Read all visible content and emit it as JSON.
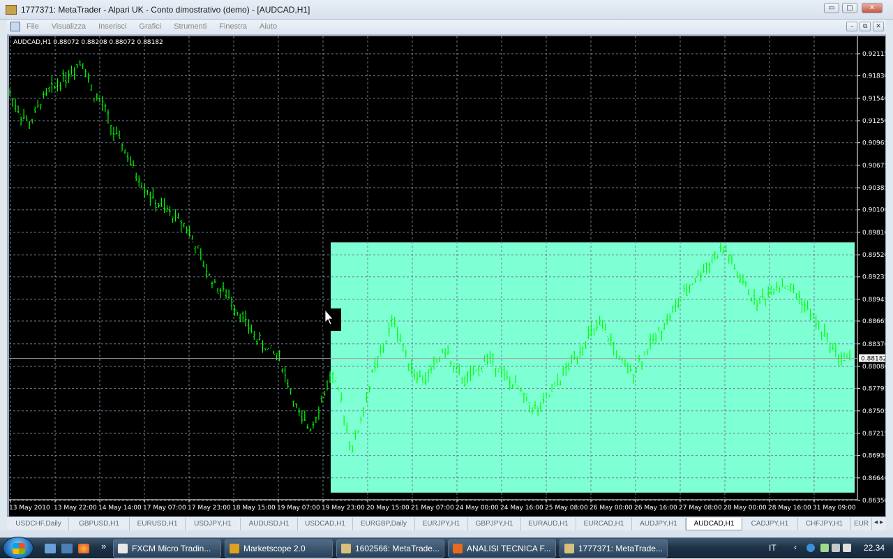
{
  "window": {
    "title": "1777371: MetaTrader - Alpari UK - Conto dimostrativo (demo) - [AUDCAD,H1]",
    "controls": {
      "minimize": "▭",
      "restore": "□",
      "close": "✕"
    }
  },
  "menu": {
    "items": [
      "File",
      "Visualizza",
      "Inserisci",
      "Grafici",
      "Strumenti",
      "Finestra",
      "Aiuto"
    ],
    "mdi_controls": {
      "minimize": "–",
      "restore": "⧉",
      "close": "✕"
    }
  },
  "chart_info": "AUDCAD,H1  0.88072 0.88208 0.88072 0.88182",
  "chart_data": {
    "type": "candlestick",
    "symbol": "AUDCAD",
    "timeframe": "H1",
    "ohlc": {
      "open": 0.88072,
      "high": 0.88208,
      "low": 0.88072,
      "close": 0.88182
    },
    "y_ticks": [
      "0.92115",
      "0.91830",
      "0.91540",
      "0.91250",
      "0.90965",
      "0.90675",
      "0.90385",
      "0.90100",
      "0.89810",
      "0.89520",
      "0.89235",
      "0.88945",
      "0.88665",
      "0.88370",
      "0.88080",
      "0.87795",
      "0.87505",
      "0.87215",
      "0.86930",
      "0.86640",
      "0.86350"
    ],
    "ylim": [
      0.8635,
      0.92115
    ],
    "current_price": "0.88182",
    "current_price_value": 0.88182,
    "x_ticks": [
      "13 May 2010",
      "13 May 22:00",
      "14 May 14:00",
      "17 May 07:00",
      "17 May 23:00",
      "18 May 15:00",
      "19 May 07:00",
      "19 May 23:00",
      "20 May 15:00",
      "21 May 07:00",
      "24 May 00:00",
      "24 May 16:00",
      "25 May 08:00",
      "26 May 00:00",
      "26 May 16:00",
      "27 May 08:00",
      "28 May 00:00",
      "28 May 16:00",
      "31 May 09:00"
    ],
    "price_path": [
      0.916,
      0.9135,
      0.912,
      0.915,
      0.9165,
      0.9178,
      0.919,
      0.9205,
      0.916,
      0.9145,
      0.911,
      0.909,
      0.906,
      0.904,
      0.902,
      0.901,
      0.9,
      0.899,
      0.896,
      0.893,
      0.891,
      0.89,
      0.888,
      0.886,
      0.884,
      0.883,
      0.882,
      0.878,
      0.874,
      0.873,
      0.876,
      0.88,
      0.876,
      0.87,
      0.8745,
      0.88,
      0.883,
      0.887,
      0.883,
      0.88,
      0.879,
      0.881,
      0.883,
      0.88,
      0.879,
      0.88,
      0.882,
      0.881,
      0.879,
      0.878,
      0.876,
      0.875,
      0.877,
      0.879,
      0.881,
      0.883,
      0.885,
      0.886,
      0.884,
      0.881,
      0.88,
      0.882,
      0.884,
      0.886,
      0.888,
      0.89,
      0.892,
      0.8935,
      0.895,
      0.896,
      0.893,
      0.891,
      0.889,
      0.89,
      0.8915,
      0.891,
      0.89,
      0.888,
      0.886,
      0.884,
      0.882,
      0.8818
    ],
    "highlight_zone": {
      "color": "#7fffd4",
      "price_range": [
        0.8645,
        0.8968
      ]
    },
    "colors": {
      "background": "#000000",
      "grid": "#6f7f8f",
      "candles": "#00ff00",
      "price_line": "#a0a0a0"
    }
  },
  "tabs": [
    "USDCHF,Daily",
    "GBPUSD,H1",
    "EURUSD,H1",
    "USDJPY,H1",
    "AUDUSD,H1",
    "USDCAD,H1",
    "EURGBP,Daily",
    "EURJPY,H1",
    "GBPJPY,H1",
    "EURAUD,H1",
    "EURCAD,H1",
    "AUDJPY,H1",
    "AUDCAD,H1",
    "CADJPY,H1",
    "CHFJPY,H1",
    "EUR"
  ],
  "active_tab": "AUDCAD,H1",
  "tab_scroll": "◂  ▸",
  "taskbar": {
    "quicklaunch_more": "»",
    "tasks": [
      {
        "label": "FXCM Micro Tradin...",
        "icon": "fx-icon"
      },
      {
        "label": "Marketscope 2.0",
        "icon": "marketscope-icon"
      },
      {
        "label": "1602566: MetaTrade...",
        "icon": "metatrader-icon"
      },
      {
        "label": "ANALISI TECNICA F...",
        "icon": "firefox-icon"
      },
      {
        "label": "1777371: MetaTrade...",
        "icon": "metatrader-icon"
      }
    ],
    "language": "IT",
    "tray_arrow": "‹",
    "clock": "22.34"
  }
}
